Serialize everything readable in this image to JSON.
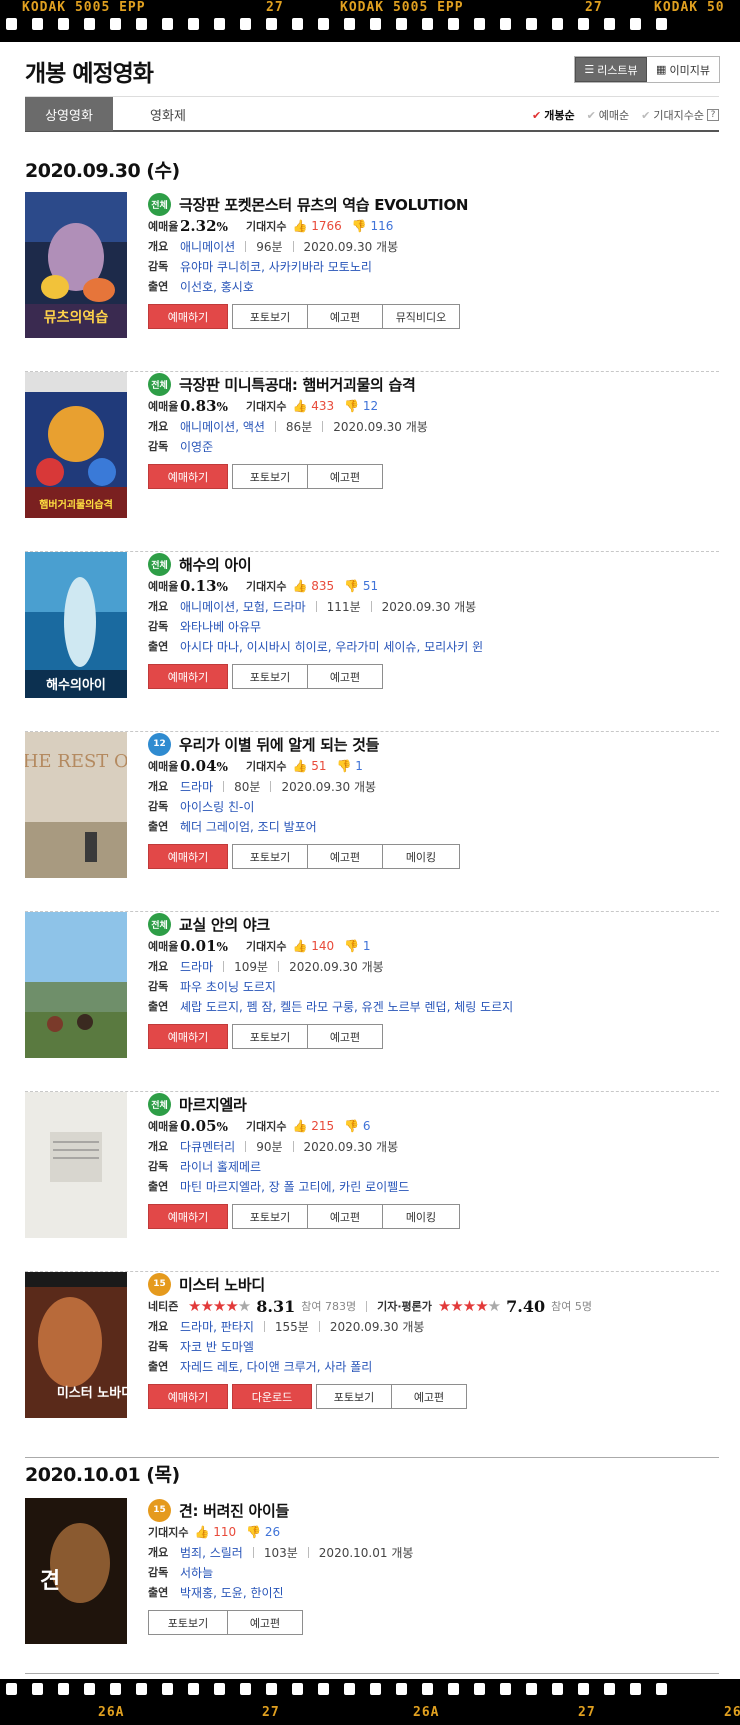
{
  "film_top": {
    "labels": [
      "KODAK  5005  EPP",
      "27",
      "KODAK  5005  EPP",
      "27",
      "KODAK  50"
    ]
  },
  "film_bottom": {
    "labels": [
      "26A",
      "27",
      "26A",
      "27",
      "26"
    ]
  },
  "header": {
    "title": "개봉 예정영화",
    "view_list": "리스트뷰",
    "view_image": "이미지뷰"
  },
  "tabs": {
    "now": "상영영화",
    "movie_info": "영화제"
  },
  "sort": {
    "open": "개봉순",
    "booking": "예매순",
    "expect": "기대지수순",
    "help": "?"
  },
  "labels": {
    "booking": "예매율",
    "expect": "기대지수",
    "overview": "개요",
    "director": "감독",
    "cast": "출연",
    "netizen": "네티즌",
    "critic": "기자·평론가"
  },
  "buttons": {
    "book": "예매하기",
    "photo": "포토보기",
    "trailer": "예고편",
    "mv": "뮤직비디오",
    "making": "메이킹",
    "download": "다운로드"
  },
  "dates": [
    "2020.09.30 (수)",
    "2020.10.01 (목)"
  ],
  "movies": [
    {
      "rating": "전체",
      "title": "극장판 포켓몬스터 뮤츠의 역습 EVOLUTION",
      "booking": "2.32",
      "pct": "%",
      "up": "1766",
      "down": "116",
      "genre": "애니메이션",
      "runtime": "96분",
      "open": "2020.09.30 개봉",
      "director": "유야마 쿠니히코, 사카키바라 모토노리",
      "cast": "이선호, 홍시호"
    },
    {
      "rating": "전체",
      "title": "극장판 미니특공대: 햄버거괴물의 습격",
      "booking": "0.83",
      "pct": "%",
      "up": "433",
      "down": "12",
      "genre": "애니메이션, 액션",
      "runtime": "86분",
      "open": "2020.09.30 개봉",
      "director": "이영준"
    },
    {
      "rating": "전체",
      "title": "해수의 아이",
      "booking": "0.13",
      "pct": "%",
      "up": "835",
      "down": "51",
      "genre": "애니메이션, 모험, 드라마",
      "runtime": "111분",
      "open": "2020.09.30 개봉",
      "director": "와타나베 아유무",
      "cast": "아시다 마나, 이시바시 히이로, 우라가미 세이슈, 모리사키 윈"
    },
    {
      "rating": "12",
      "title": "우리가 이별 뒤에 알게 되는 것들",
      "booking": "0.04",
      "pct": "%",
      "up": "51",
      "down": "1",
      "genre": "드라마",
      "runtime": "80분",
      "open": "2020.09.30 개봉",
      "director": "아이스링 친-이",
      "cast": "헤더 그레이엄, 조디 발포어"
    },
    {
      "rating": "전체",
      "title": "교실 안의 야크",
      "booking": "0.01",
      "pct": "%",
      "up": "140",
      "down": "1",
      "genre": "드라마",
      "runtime": "109분",
      "open": "2020.09.30 개봉",
      "director": "파우 초이닝 도르지",
      "cast": "셰랍 도르지, 펨 잠, 켈든 라모 구룽, 유겐 노르부 렌덥, 체링 도르지"
    },
    {
      "rating": "전체",
      "title": "마르지엘라",
      "booking": "0.05",
      "pct": "%",
      "up": "215",
      "down": "6",
      "genre": "다큐멘터리",
      "runtime": "90분",
      "open": "2020.09.30 개봉",
      "director": "라이너 홀제메르",
      "cast": "마틴 마르지엘라, 장 폴 고티에, 카린 로이펠드"
    },
    {
      "rating": "15",
      "title": "미스터 노바디",
      "netizen_score": "8.31",
      "netizen_count": "참여 783명",
      "critic_score": "7.40",
      "critic_count": "참여 5명",
      "netizen_stars": 4,
      "critic_stars": 4,
      "genre": "드라마, 판타지",
      "runtime": "155분",
      "open": "2020.09.30 개봉",
      "director": "자코 반 도마엘",
      "cast": "자레드 레토, 다이앤 크루거, 사라 폴리"
    },
    {
      "rating": "15",
      "title": "견: 버려진 아이들",
      "up": "110",
      "down": "26",
      "genre": "범죄, 스릴러",
      "runtime": "103분",
      "open": "2020.10.01 개봉",
      "director": "서하늘",
      "cast": "박재홍, 도윤, 한이진"
    }
  ],
  "poster_texts": {
    "p2": "뮤츠의역습",
    "p3": "햄버거괴물의습격",
    "p4": "해수의아이",
    "p5": "THE REST OF",
    "p9": "미스터 노바디",
    "p10": "견"
  }
}
